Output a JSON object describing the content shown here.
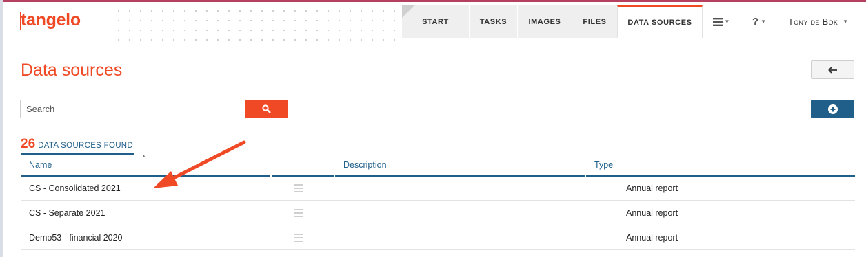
{
  "app": {
    "logo": "tangelo"
  },
  "nav": {
    "tabs": [
      {
        "label": "START"
      },
      {
        "label": "TASKS"
      },
      {
        "label": "IMAGES"
      },
      {
        "label": "FILES"
      },
      {
        "label": "DATA SOURCES",
        "active": true
      }
    ],
    "menu_icon": "hamburger-icon",
    "help_label": "?",
    "user": "Tony de Bok"
  },
  "page": {
    "title": "Data sources",
    "back_icon": "back-arrow-icon"
  },
  "search": {
    "placeholder": "Search",
    "value": "",
    "button_icon": "search-icon"
  },
  "add_icon": "plus-circle-icon",
  "results": {
    "count": "26",
    "label": "DATA SOURCES FOUND"
  },
  "table": {
    "columns": [
      "Name",
      "",
      "Description",
      "Type"
    ],
    "rows": [
      {
        "name": "CS - Consolidated 2021",
        "description": "",
        "type": "Annual report"
      },
      {
        "name": "CS - Separate 2021",
        "description": "",
        "type": "Annual report"
      },
      {
        "name": "Demo53 - financial 2020",
        "description": "",
        "type": "Annual report"
      }
    ]
  },
  "colors": {
    "brand": "#ef4a25",
    "accent": "#1f5f8a",
    "top_rule": "#b5405f"
  }
}
